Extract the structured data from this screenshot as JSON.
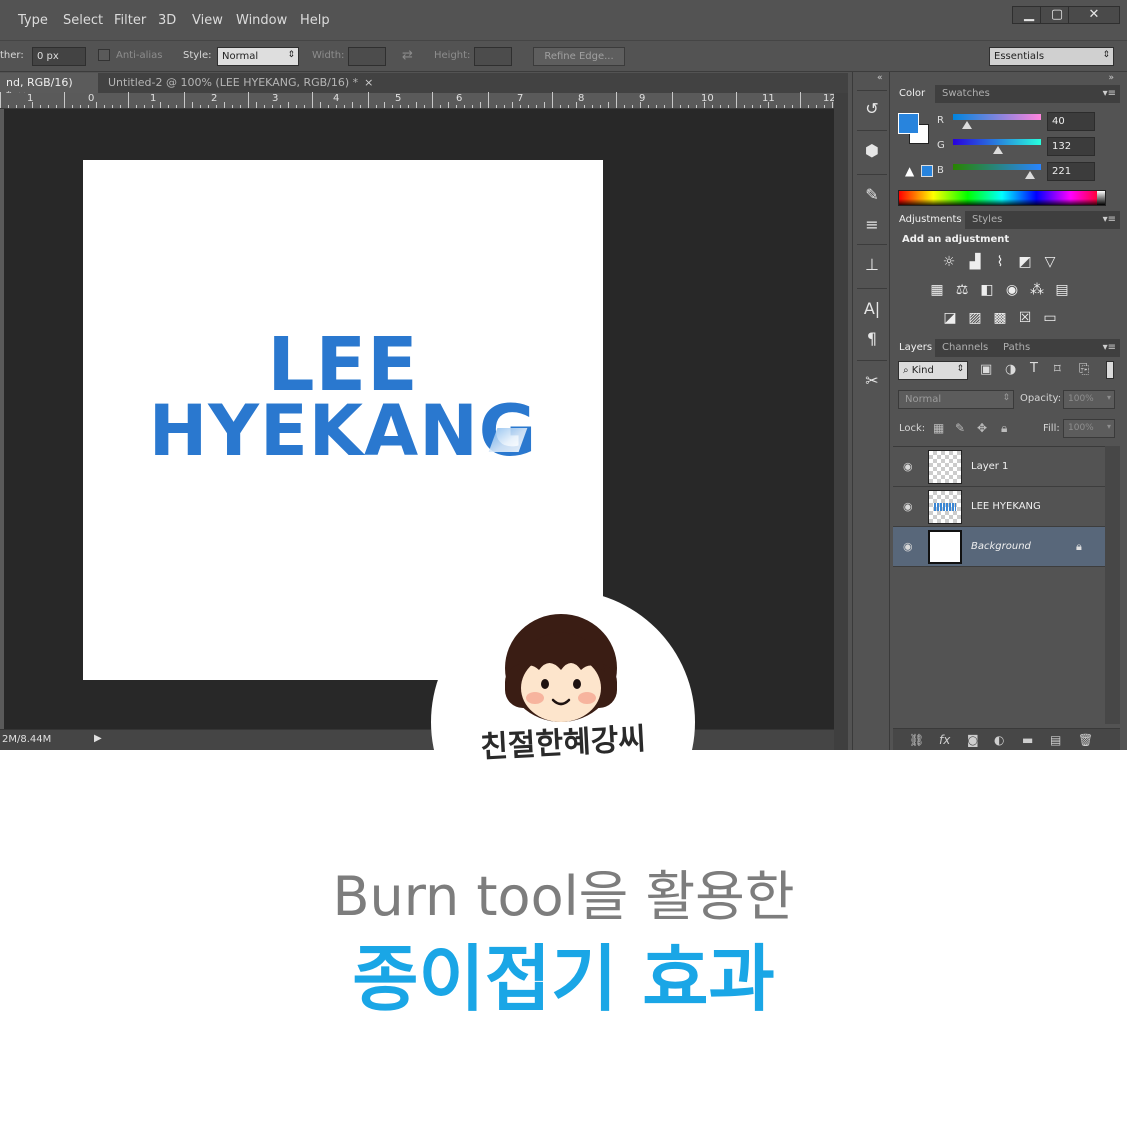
{
  "menu": {
    "items": [
      "Type",
      "Select",
      "Filter",
      "3D",
      "View",
      "Window",
      "Help"
    ]
  },
  "window": {
    "minimize": "▁",
    "maximize": "▢",
    "close": "✕"
  },
  "options": {
    "feather_label": "ther:",
    "feather_value": "0 px",
    "antialias_label": "Anti-alias",
    "style_label": "Style:",
    "style_value": "Normal",
    "width_label": "Width:",
    "height_label": "Height:",
    "refine_edge": "Refine Edge...",
    "workspace": "Essentials"
  },
  "tabs": [
    {
      "label": "nd, RGB/16) *",
      "active": true
    },
    {
      "label": "Untitled-2 @ 100% (LEE HYEKANG, RGB/16) *",
      "active": false
    }
  ],
  "ruler": [
    "1",
    "0",
    "1",
    "2",
    "3",
    "4",
    "5",
    "6",
    "7",
    "8",
    "9",
    "10",
    "11",
    "12"
  ],
  "document": {
    "line1": "LEE",
    "line2": "HYEKANG"
  },
  "status": {
    "doc_size": "2M/8.44M"
  },
  "color_panel": {
    "tabs": [
      "Color",
      "Swatches"
    ],
    "r_label": "R",
    "g_label": "G",
    "b_label": "B",
    "r": "40",
    "g": "132",
    "b": "221",
    "foreground": "#2884dd"
  },
  "adjustments_panel": {
    "tabs": [
      "Adjustments",
      "Styles"
    ],
    "heading": "Add an adjustment"
  },
  "layers_panel": {
    "tabs": [
      "Layers",
      "Channels",
      "Paths"
    ],
    "filter_kind": "Kind",
    "blend_mode": "Normal",
    "opacity_label": "Opacity:",
    "opacity_value": "100%",
    "lock_label": "Lock:",
    "fill_label": "Fill:",
    "fill_value": "100%",
    "layers": [
      {
        "name": "Layer 1"
      },
      {
        "name": "LEE HYEKANG"
      },
      {
        "name": "Background"
      }
    ]
  },
  "caption": {
    "subtitle": "Burn tool을 활용한",
    "title": "종이접기 효과",
    "logo_text": "친절한혜강씨"
  },
  "colors": {
    "accent_blue": "#1aa6e6",
    "text_blue": "#2a78cf",
    "panel_bg": "#535353"
  }
}
